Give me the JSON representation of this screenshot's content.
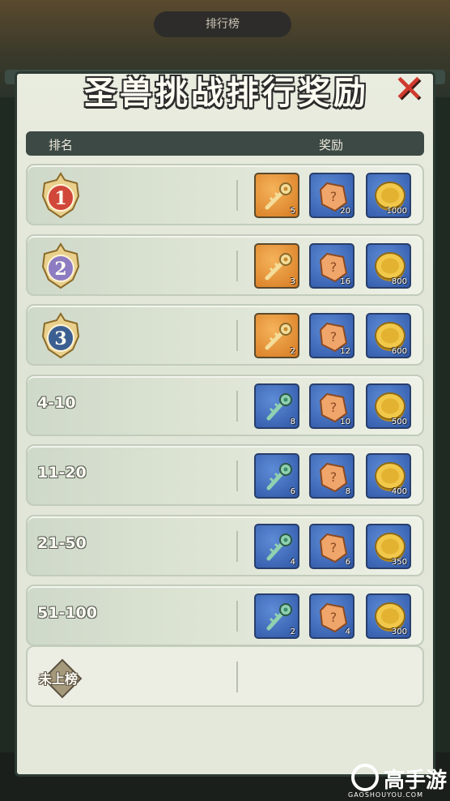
{
  "top_tab": "排行榜",
  "title": "圣兽挑战排行奖励",
  "close_icon": "close-x-icon",
  "header": {
    "rank": "排名",
    "reward": "奖励"
  },
  "colors": {
    "orange_slot": "#e08a2e",
    "blue_slot": "#3a64b4",
    "panel": "#e4e8db",
    "header": "#3c4945"
  },
  "rows": [
    {
      "rank": "1",
      "rank_type": "medal",
      "medal_color": "#d1473a",
      "rewards": [
        {
          "icon": "golden-key-icon",
          "slot": "orange",
          "count": "5"
        },
        {
          "icon": "crystal-icon",
          "slot": "blue",
          "count": "20"
        },
        {
          "icon": "gold-coin-icon",
          "slot": "blue",
          "count": "1000"
        }
      ]
    },
    {
      "rank": "2",
      "rank_type": "medal",
      "medal_color": "#8d7cc2",
      "rewards": [
        {
          "icon": "golden-key-icon",
          "slot": "orange",
          "count": "3"
        },
        {
          "icon": "crystal-icon",
          "slot": "blue",
          "count": "16"
        },
        {
          "icon": "gold-coin-icon",
          "slot": "blue",
          "count": "800"
        }
      ]
    },
    {
      "rank": "3",
      "rank_type": "medal",
      "medal_color": "#3c5f92",
      "rewards": [
        {
          "icon": "golden-key-icon",
          "slot": "orange",
          "count": "2"
        },
        {
          "icon": "crystal-icon",
          "slot": "blue",
          "count": "12"
        },
        {
          "icon": "gold-coin-icon",
          "slot": "blue",
          "count": "600"
        }
      ]
    },
    {
      "rank": "4-10",
      "rank_type": "text",
      "rewards": [
        {
          "icon": "jade-key-icon",
          "slot": "blue",
          "count": "8"
        },
        {
          "icon": "crystal-icon",
          "slot": "blue",
          "count": "10"
        },
        {
          "icon": "gold-coin-icon",
          "slot": "blue",
          "count": "500"
        }
      ]
    },
    {
      "rank": "11-20",
      "rank_type": "text",
      "rewards": [
        {
          "icon": "jade-key-icon",
          "slot": "blue",
          "count": "6"
        },
        {
          "icon": "crystal-icon",
          "slot": "blue",
          "count": "8"
        },
        {
          "icon": "gold-coin-icon",
          "slot": "blue",
          "count": "400"
        }
      ]
    },
    {
      "rank": "21-50",
      "rank_type": "text",
      "rewards": [
        {
          "icon": "jade-key-icon",
          "slot": "blue",
          "count": "4"
        },
        {
          "icon": "crystal-icon",
          "slot": "blue",
          "count": "6"
        },
        {
          "icon": "gold-coin-icon",
          "slot": "blue",
          "count": "350"
        }
      ]
    },
    {
      "rank": "51-100",
      "rank_type": "text",
      "rewards": [
        {
          "icon": "jade-key-icon",
          "slot": "blue",
          "count": "2"
        },
        {
          "icon": "crystal-icon",
          "slot": "blue",
          "count": "4"
        },
        {
          "icon": "gold-coin-icon",
          "slot": "blue",
          "count": "300"
        }
      ]
    }
  ],
  "unranked": {
    "label": "未上榜"
  },
  "watermark": {
    "text": "高手游",
    "sub": "GAOSHOUYOU.COM"
  }
}
